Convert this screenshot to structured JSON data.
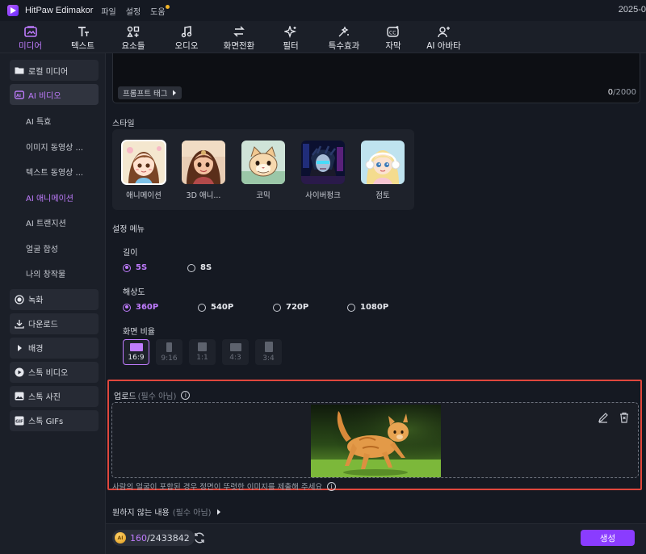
{
  "titlebar": {
    "app_name": "HitPaw Edimakor",
    "menu": [
      "파일",
      "설정",
      "도움"
    ],
    "date": "2025-0"
  },
  "toolbar": {
    "items": [
      {
        "label": "미디어",
        "icon": "media-icon",
        "active": true
      },
      {
        "label": "텍스트",
        "icon": "text-icon",
        "active": false
      },
      {
        "label": "요소들",
        "icon": "elements-icon",
        "active": false
      },
      {
        "label": "오디오",
        "icon": "audio-icon",
        "active": false
      },
      {
        "label": "화면전환",
        "icon": "transition-icon",
        "active": false
      },
      {
        "label": "필터",
        "icon": "filter-icon",
        "active": false
      },
      {
        "label": "특수효과",
        "icon": "effects-icon",
        "active": false
      },
      {
        "label": "자막",
        "icon": "subtitle-icon",
        "active": false
      },
      {
        "label": "AI 아바타",
        "icon": "ai-avatar-icon",
        "active": false
      }
    ]
  },
  "sidebar": {
    "local_media": "로컬 미디어",
    "ai_video": "AI 비디오",
    "sub_items": [
      "AI 특효",
      "이미지 동영상 ...",
      "텍스트 동영상 ...",
      "AI 애니메이션",
      "AI 트랜지션",
      "얼굴 합성",
      "나의 창작물"
    ],
    "active_sub": 3,
    "record": "녹화",
    "download": "다운로드",
    "background": "배경",
    "stock_video": "스톡 비디오",
    "stock_photo": "스톡 사진",
    "stock_gifs": "스톡 GIFs"
  },
  "prompt": {
    "tag_button": "프롬프트 태그",
    "count_current": "0",
    "count_max": "/2000"
  },
  "style": {
    "title": "스타일",
    "items": [
      "애니메이션",
      "3D 애니...",
      "코믹",
      "사이버펑크",
      "점토"
    ],
    "selected": 0
  },
  "settings": {
    "title": "설정 메뉴",
    "length": {
      "label": "길이",
      "options": [
        "5S",
        "8S"
      ],
      "selected": 0
    },
    "resolution": {
      "label": "해상도",
      "options": [
        "360P",
        "540P",
        "720P",
        "1080P"
      ],
      "selected": 0
    },
    "aspect": {
      "label": "화면 비율",
      "options": [
        "16:9",
        "9:16",
        "1:1",
        "4:3",
        "3:4"
      ],
      "selected": 0
    }
  },
  "upload": {
    "title": "업로드",
    "optional": "(필수 아님)",
    "note": "사람의 얼굴이 포함된 경우 정면이 뚜렷한 이미지를 제출해 주세요"
  },
  "negative": {
    "title": "원하지 않는 내용",
    "optional": "(필수 아님)"
  },
  "bottom": {
    "coin_label": "AI",
    "credits_used": "160",
    "credits_total": "/2433842",
    "generate": "생성"
  },
  "colors": {
    "accent": "#c07cff",
    "button": "#8a3cff",
    "highlight_border": "#e0473d"
  }
}
